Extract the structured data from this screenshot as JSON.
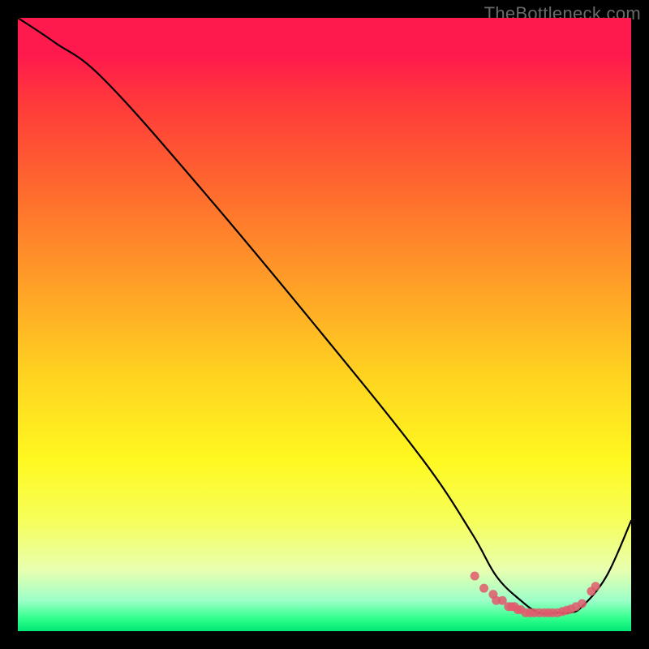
{
  "watermark": "TheBottleneck.com",
  "chart_data": {
    "type": "line",
    "title": "",
    "xlabel": "",
    "ylabel": "",
    "xlim": [
      0,
      100
    ],
    "ylim": [
      0,
      100
    ],
    "grid": false,
    "legend": false,
    "series": [
      {
        "name": "curve",
        "x": [
          0,
          6,
          14,
          30,
          50,
          66,
          74,
          78,
          82,
          85,
          88,
          90,
          92,
          96,
          100
        ],
        "y": [
          100,
          96,
          90,
          72,
          48,
          28,
          16,
          9,
          5,
          3,
          3,
          3,
          4,
          9,
          18
        ]
      }
    ],
    "markers": {
      "name": "bottom-cluster",
      "x": [
        74.5,
        76,
        77.5,
        78,
        79,
        80,
        80.5,
        81,
        81.5,
        82,
        82.8,
        83.5,
        84.2,
        85,
        85.8,
        86.5,
        87.2,
        88,
        88.8,
        89.5,
        90.2,
        91,
        92,
        93.5,
        94.2
      ],
      "y": [
        9,
        7,
        6,
        5,
        5,
        4,
        4,
        4,
        3.5,
        3.5,
        3,
        3,
        3,
        3,
        3,
        3,
        3,
        3,
        3.2,
        3.4,
        3.6,
        4,
        4.5,
        6.5,
        7.3
      ]
    }
  }
}
